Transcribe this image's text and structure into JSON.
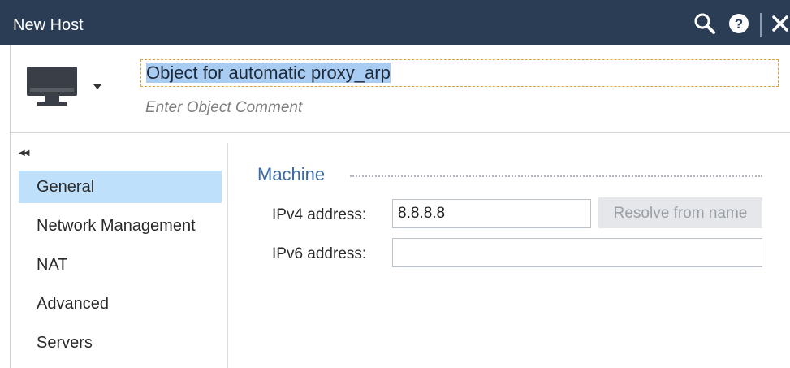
{
  "window": {
    "title": "New Host"
  },
  "header": {
    "object_name": "Object for automatic proxy_arp",
    "comment_placeholder": "Enter Object Comment"
  },
  "icons": {
    "search": "search-icon",
    "help": "help-icon",
    "close": "close-icon",
    "host": "monitor-icon",
    "collapse": "collapse-left-icon"
  },
  "sidebar": {
    "items": [
      {
        "label": "General",
        "active": true
      },
      {
        "label": "Network Management",
        "active": false
      },
      {
        "label": "NAT",
        "active": false
      },
      {
        "label": "Advanced",
        "active": false
      },
      {
        "label": "Servers",
        "active": false
      }
    ]
  },
  "machine": {
    "section_title": "Machine",
    "ipv4_label": "IPv4 address:",
    "ipv4_value": "8.8.8.8",
    "ipv6_label": "IPv6 address:",
    "ipv6_value": "",
    "resolve_label": "Resolve from name"
  },
  "colors": {
    "titlebar": "#2b3c55",
    "active_nav": "#bfe0fb",
    "section_title": "#3a6aa5",
    "selection": "#a9cdf2"
  }
}
